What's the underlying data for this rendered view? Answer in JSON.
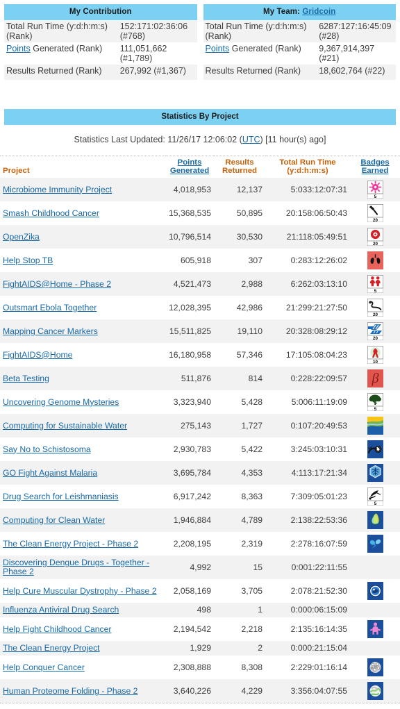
{
  "summary": {
    "contribution": {
      "title": "My Contribution",
      "rows": [
        {
          "label": "Total Run Time (y:d:h:m:s) (Rank)",
          "value": "152:171:02:36:06 (#768)"
        },
        {
          "label_link": "Points",
          "label_rest": " Generated (Rank)",
          "value": "111,051,662 (#1,789)"
        },
        {
          "label": "Results Returned (Rank)",
          "value": "267,992 (#1,367)"
        }
      ]
    },
    "team": {
      "title_prefix": "My Team: ",
      "title_link": "Gridcoin",
      "rows": [
        {
          "label": "Total Run Time (y:d:h:m:s) (Rank)",
          "value": "6287:127:16:45:09 (#28)"
        },
        {
          "label_link": "Points",
          "label_rest": " Generated (Rank)",
          "value": "9,367,914,397 (#21)"
        },
        {
          "label": "Results Returned (Rank)",
          "value": "18,602,764 (#22)"
        }
      ]
    }
  },
  "stats_section": {
    "bar_title": "Statistics By Project",
    "last_updated_prefix": "Statistics Last Updated: 11/26/17 12:06:02 (",
    "last_updated_link": "UTC",
    "last_updated_suffix": ") [11 hour(s) ago]"
  },
  "table": {
    "headers": {
      "project": "Project",
      "points_line1": "Points",
      "points_line2": "Generated",
      "results_line1": "Results",
      "results_line2": "Returned",
      "runtime_line1": "Total Run Time",
      "runtime_line2": "(y:d:h:m:s)",
      "badges_line1": "Badges",
      "badges_line2": "Earned"
    },
    "rows": [
      {
        "project": "Microbiome Immunity Project",
        "points": "4,018,953",
        "results": "12,137",
        "runtime": "5:033:12:07:31",
        "badge": "microbiome-badge",
        "badge_level": "5"
      },
      {
        "project": "Smash Childhood Cancer",
        "points": "15,368,535",
        "results": "50,895",
        "runtime": "20:158:06:50:43",
        "badge": "smash-childhood-cancer-badge",
        "badge_level": "20"
      },
      {
        "project": "OpenZika",
        "points": "10,796,514",
        "results": "30,530",
        "runtime": "21:118:05:49:51",
        "badge": "openzika-badge",
        "badge_level": "20"
      },
      {
        "project": "Help Stop TB",
        "points": "605,918",
        "results": "307",
        "runtime": "0:283:12:26:02",
        "badge": "help-stop-tb-badge",
        "badge_level": ""
      },
      {
        "project": "FightAIDS@Home - Phase 2",
        "points": "4,521,473",
        "results": "2,988",
        "runtime": "6:262:03:13:10",
        "badge": "fightaids-phase2-badge",
        "badge_level": "5"
      },
      {
        "project": "Outsmart Ebola Together",
        "points": "12,028,395",
        "results": "42,986",
        "runtime": "21:299:21:27:50",
        "badge": "outsmart-ebola-badge",
        "badge_level": "20"
      },
      {
        "project": "Mapping Cancer Markers",
        "points": "15,511,825",
        "results": "19,110",
        "runtime": "20:328:08:29:12",
        "badge": "mapping-cancer-markers-badge",
        "badge_level": "20"
      },
      {
        "project": "FightAIDS@Home",
        "points": "16,180,958",
        "results": "57,346",
        "runtime": "17:105:08:04:23",
        "badge": "fightaids-badge",
        "badge_level": "10"
      },
      {
        "project": "Beta Testing",
        "points": "511,876",
        "results": "814",
        "runtime": "0:228:22:09:57",
        "badge": "beta-testing-badge",
        "badge_level": ""
      },
      {
        "project": "Uncovering Genome Mysteries",
        "points": "3,323,940",
        "results": "5,428",
        "runtime": "5:006:11:19:09",
        "badge": "uncovering-genome-badge",
        "badge_level": "5"
      },
      {
        "project": "Computing for Sustainable Water",
        "points": "275,143",
        "results": "1,727",
        "runtime": "0:107:20:49:53",
        "badge": "sustainable-water-badge",
        "badge_level": ""
      },
      {
        "project": "Say No to Schistosoma",
        "points": "2,930,783",
        "results": "5,422",
        "runtime": "3:245:03:10:31",
        "badge": "schistosoma-badge",
        "badge_level": ""
      },
      {
        "project": "GO Fight Against Malaria",
        "points": "3,695,784",
        "results": "4,353",
        "runtime": "4:113:17:21:34",
        "badge": "malaria-badge",
        "badge_level": ""
      },
      {
        "project": "Drug Search for Leishmaniasis",
        "points": "6,917,242",
        "results": "8,363",
        "runtime": "7:309:05:01:23",
        "badge": "leishmaniasis-badge",
        "badge_level": "5"
      },
      {
        "project": "Computing for Clean Water",
        "points": "1,946,884",
        "results": "4,789",
        "runtime": "2:138:22:53:36",
        "badge": "clean-water-badge",
        "badge_level": ""
      },
      {
        "project": "The Clean Energy Project - Phase 2",
        "points": "2,208,195",
        "results": "2,319",
        "runtime": "2:278:16:07:59",
        "badge": "clean-energy-phase2-badge",
        "badge_level": ""
      },
      {
        "project": "Discovering Dengue Drugs - Together - Phase 2",
        "points": "4,992",
        "results": "15",
        "runtime": "0:001:22:11:55",
        "badge": "",
        "badge_level": ""
      },
      {
        "project": "Help Cure Muscular Dystrophy - Phase 2",
        "points": "2,058,169",
        "results": "3,705",
        "runtime": "2:078:21:52:30",
        "badge": "muscular-dystrophy-badge",
        "badge_level": ""
      },
      {
        "project": "Influenza Antiviral Drug Search",
        "points": "498",
        "results": "1",
        "runtime": "0:000:06:15:09",
        "badge": "",
        "badge_level": ""
      },
      {
        "project": "Help Fight Childhood Cancer",
        "points": "2,194,542",
        "results": "2,218",
        "runtime": "2:135:16:14:35",
        "badge": "help-fight-childhood-cancer-badge",
        "badge_level": ""
      },
      {
        "project": "The Clean Energy Project",
        "points": "1,929",
        "results": "2",
        "runtime": "0:000:21:15:04",
        "badge": "",
        "badge_level": ""
      },
      {
        "project": "Help Conquer Cancer",
        "points": "2,308,888",
        "results": "8,308",
        "runtime": "2:229:01:16:14",
        "badge": "help-conquer-cancer-badge",
        "badge_level": ""
      },
      {
        "project": "Human Proteome Folding - Phase 2",
        "points": "3,640,226",
        "results": "4,229",
        "runtime": "3:356:04:07:55",
        "badge": "human-proteome-folding-badge",
        "badge_level": ""
      }
    ]
  },
  "colors": {
    "header_bar": "#7cd0f2",
    "link": "#1569a8",
    "column_header": "#c8620a",
    "row_alt": "#f2f2f2"
  }
}
